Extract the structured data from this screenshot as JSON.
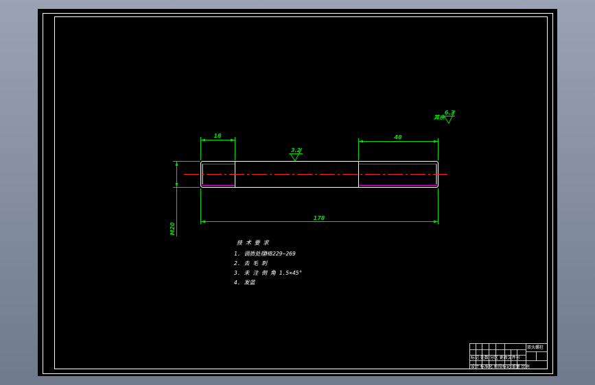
{
  "drawing": {
    "dims": {
      "left_thread_len": "18",
      "right_thread_len": "48",
      "total_len": "178",
      "diameter": "M20",
      "roughness_center": "3.2",
      "roughness_corner": "6.3",
      "roughness_corner_prefix": "其余"
    },
    "notes": {
      "title": "技 术 要 求",
      "items": [
        "1. 调质处理HB229~269",
        "2. 去 毛 刺",
        "3. 未 注 倒 角 1.5×45°",
        "4. 发蓝"
      ]
    },
    "title_block": {
      "part_name": "双头螺柱",
      "row1": "标记 处数 分区 更改文件号",
      "row2": "设计 标准化 阶段标记 重量 比例"
    }
  },
  "colors": {
    "line_white": "#ffffff",
    "dim_green": "#00e000",
    "thread_magenta": "#e000e0",
    "center_red": "#ff2020"
  }
}
